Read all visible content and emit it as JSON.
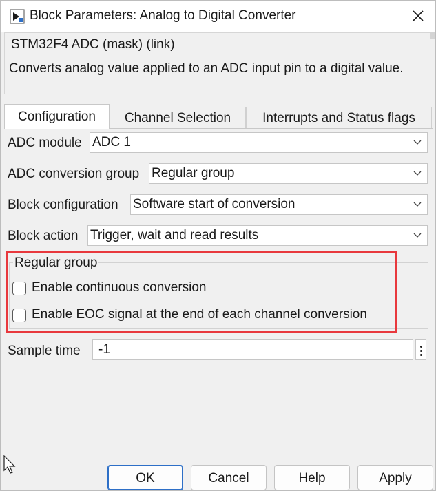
{
  "window": {
    "title": "Block Parameters: Analog to Digital Converter"
  },
  "description": {
    "title": "STM32F4 ADC (mask) (link)",
    "text": "Converts analog value applied to an ADC input pin to a digital value."
  },
  "tabs": [
    {
      "label": "Configuration",
      "active": true
    },
    {
      "label": "Channel Selection",
      "active": false
    },
    {
      "label": "Interrupts and Status flags",
      "active": false
    }
  ],
  "params": {
    "adc_module": {
      "label": "ADC module",
      "value": "ADC 1"
    },
    "conversion_group": {
      "label": "ADC conversion group",
      "value": "Regular group"
    },
    "block_configuration": {
      "label": "Block configuration",
      "value": "Software start of conversion"
    },
    "block_action": {
      "label": "Block action",
      "value": "Trigger, wait and read results"
    }
  },
  "regular_group": {
    "title": "Regular group",
    "checkboxes": [
      {
        "label": "Enable continuous conversion",
        "checked": false
      },
      {
        "label": "Enable EOC signal at the end of each channel conversion",
        "checked": false
      }
    ]
  },
  "sample_time": {
    "label": "Sample time",
    "value": "-1"
  },
  "buttons": {
    "ok": "OK",
    "cancel": "Cancel",
    "help": "Help",
    "apply": "Apply"
  },
  "colors": {
    "highlight": "#e8383d",
    "default_button_border": "#2d6fc7",
    "dialog_background": "#f0f0f0"
  },
  "icons": {
    "app": "simulink-block-icon",
    "close": "close-icon",
    "dropdown": "chevron-down-icon",
    "more": "vertical-ellipsis-icon",
    "cursor": "mouse-pointer-icon"
  }
}
